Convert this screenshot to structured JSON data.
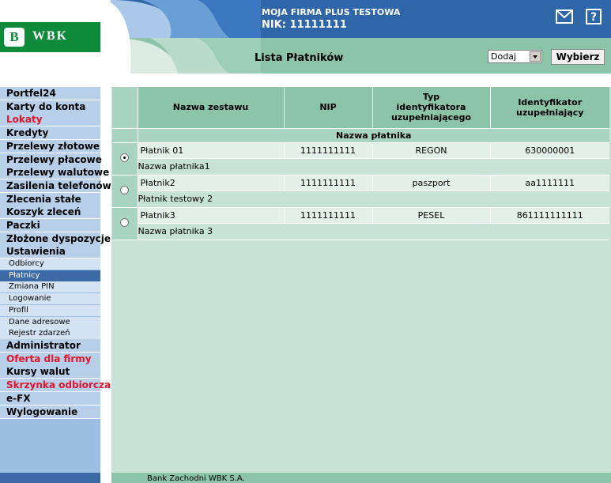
{
  "header": {
    "firm_name": "MOJA FIRMA PLUS TESTOWA",
    "nik": "NIK: 11111111",
    "logo_text": "WBK",
    "logo_mark": "B",
    "page_title": "Lista Płatników",
    "action_select": {
      "selected": "Dodaj"
    },
    "choose_button": "Wybierz",
    "icons": {
      "mail": "mail-icon",
      "help": "help-icon"
    }
  },
  "sidebar": {
    "items": [
      {
        "label": "Portfel24",
        "highlight": false
      },
      {
        "label": "Karty do konta",
        "highlight": false
      },
      {
        "label": "Lokaty",
        "highlight": true
      },
      {
        "label": "Kredyty",
        "highlight": false
      },
      {
        "label": "Przelewy złotowe",
        "highlight": false
      },
      {
        "label": "Przelewy płacowe",
        "highlight": false
      },
      {
        "label": "Przelewy walutowe",
        "highlight": false
      },
      {
        "label": "Zasilenia telefonów",
        "highlight": false
      },
      {
        "label": "Zlecenia stałe",
        "highlight": false
      },
      {
        "label": "Koszyk zleceń",
        "highlight": false
      },
      {
        "label": "Paczki",
        "highlight": false
      },
      {
        "label": "Złożone dyspozycje",
        "highlight": false
      },
      {
        "label": "Ustawienia",
        "highlight": false
      }
    ],
    "settings_subitems": [
      {
        "label": "Odbiorcy",
        "active": false
      },
      {
        "label": "Płatnicy",
        "active": true
      },
      {
        "label": "Zmiana PIN",
        "active": false
      },
      {
        "label": "Logowanie",
        "active": false
      },
      {
        "label": "Profil",
        "active": false
      },
      {
        "label": "Dane adresowe",
        "active": false
      },
      {
        "label": "Rejestr zdarzeń",
        "active": false
      }
    ],
    "items_after": [
      {
        "label": "Administrator",
        "highlight": false
      },
      {
        "label": "Oferta dla firmy",
        "highlight": true
      },
      {
        "label": "Kursy walut",
        "highlight": false
      },
      {
        "label": "Skrzynka odbiorcza",
        "highlight": true
      },
      {
        "label": "e-FX",
        "highlight": false
      },
      {
        "label": "Wylogowanie",
        "highlight": false
      }
    ]
  },
  "table": {
    "columns": {
      "set_name": "Nazwa zestawu",
      "nip": "NIP",
      "id_type_line1": "Typ",
      "id_type_line2": "identyfikatora",
      "id_type_line3": "uzupełniającego",
      "id_value_line1": "Identyfikator",
      "id_value_line2": "uzupełniający"
    },
    "subheader": "Nazwa płatnika",
    "rows": [
      {
        "set_name": "Płatnik 01",
        "nip": "1111111111",
        "id_type": "REGON",
        "id_value": "630000001",
        "payer_name": "Nazwa płatnika1",
        "selected": true
      },
      {
        "set_name": "Płatnik2",
        "nip": "1111111111",
        "id_type": "paszport",
        "id_value": "aa1111111",
        "payer_name": "Płatnik testowy 2",
        "selected": false
      },
      {
        "set_name": "Płatnik3",
        "nip": "1111111111",
        "id_type": "PESEL",
        "id_value": "861111111111",
        "payer_name": "Nazwa płatnika 3",
        "selected": false
      }
    ]
  },
  "footer": {
    "text": "Bank Zachodni WBK S.A."
  },
  "colors": {
    "brand_green": "#0d8a3a",
    "header_teal": "#8cc4aa",
    "sidebar_blue": "#b7cfe9",
    "alert_red": "#e5142a",
    "active_blue": "#3b6aa6"
  }
}
